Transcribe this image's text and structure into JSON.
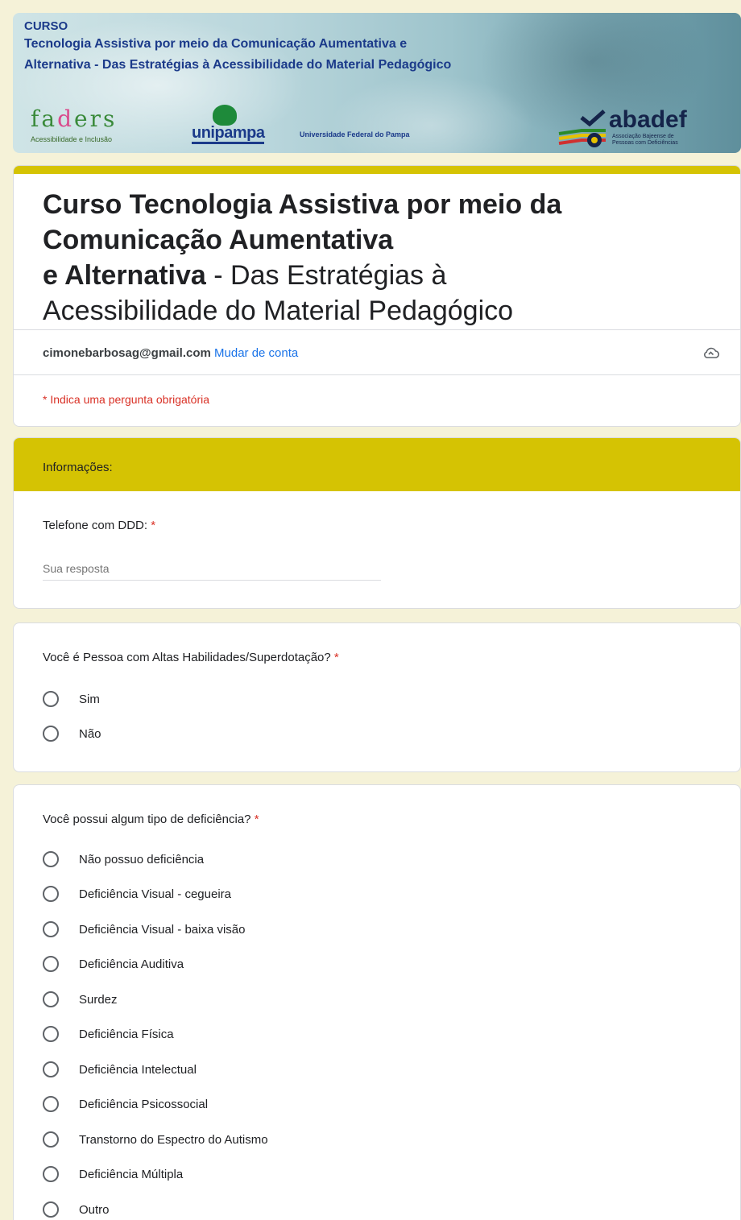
{
  "banner": {
    "curso_label": "CURSO",
    "title_line1": "Tecnologia Assistiva por meio da Comunicação Aumentativa e",
    "title_line2": "Alternativa - Das Estratégias à Acessibilidade do Material Pedagógico",
    "logos": {
      "faders_name": "fa ders",
      "faders_tagline": "Acessibilidade e Inclusão",
      "unipampa_name": "unipampa",
      "unipampa_full": "Universidade Federal do Pampa",
      "abadef_name": "abadef",
      "abadef_tagline_1": "Associação Bajeense de",
      "abadef_tagline_2": "Pessoas com Deficiências"
    }
  },
  "form": {
    "title_bold_1": "Curso Tecnologia Assistiva por meio da",
    "title_bold_2": "Comunicação Aumentativa",
    "title_bold_3": "e Alternativa",
    "title_rest_1": " - Das Estratégias à",
    "title_rest_2": "Acessibilidade do Material Pedagógico",
    "account_email": "cimonebarbosag@gmail.com",
    "switch_account": "Mudar de conta",
    "required_note": "* Indica uma pergunta obrigatória",
    "accent_color": "#d5c303"
  },
  "section": {
    "title": "Informações:"
  },
  "questions": [
    {
      "title": "Telefone com DDD:",
      "required": "*",
      "placeholder": "Sua resposta"
    },
    {
      "title": "Você é Pessoa com Altas Habilidades/Superdotação?",
      "required": "*",
      "options": [
        "Sim",
        "Não"
      ]
    },
    {
      "title": "Você possui algum tipo de deficiência?",
      "required": "*",
      "options": [
        "Não possuo deficiência",
        "Deficiência Visual - cegueira",
        "Deficiência Visual - baixa visão",
        "Deficiência Auditiva",
        "Surdez",
        "Deficiência Física",
        "Deficiência Intelectual",
        "Deficiência Psicossocial",
        "Transtorno do Espectro do Autismo",
        "Deficiência Múltipla",
        "Outro"
      ]
    }
  ],
  "icons": {
    "cloud": "cloud-save-icon"
  }
}
